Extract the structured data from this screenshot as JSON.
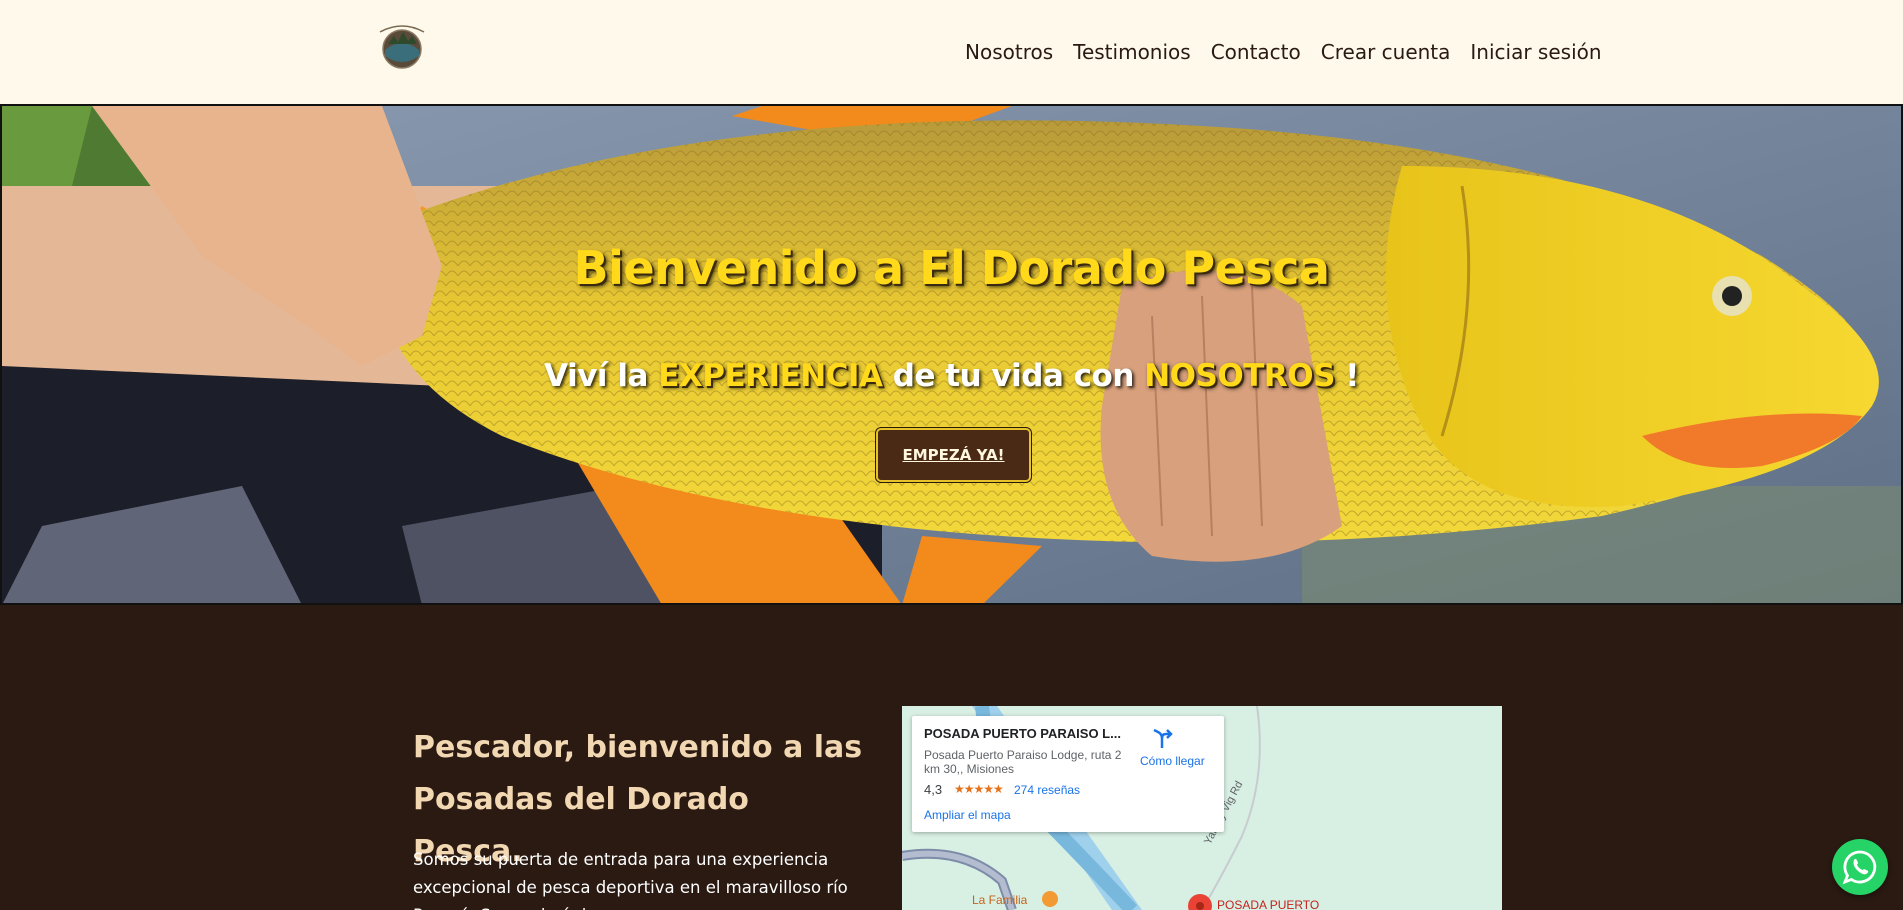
{
  "header": {
    "logo": {
      "icon": "lodge-logo-icon"
    },
    "nav": [
      {
        "label": "Nosotros"
      },
      {
        "label": "Testimonios"
      },
      {
        "label": "Contacto"
      },
      {
        "label": "Crear cuenta"
      },
      {
        "label": "Iniciar sesión"
      }
    ]
  },
  "hero": {
    "title": "Bienvenido a El Dorado Pesca",
    "subtitle_prefix": "Viví la ",
    "subtitle_highlight_1": "EXPERIENCIA",
    "subtitle_middle": " de tu vida con ",
    "subtitle_highlight_2": "NOSOTROS",
    "subtitle_suffix": " !",
    "cta_label": "EMPEZÁ YA!",
    "highlight_color": "#ffd91a"
  },
  "about": {
    "title": "Pescador, bienvenido a las Posadas del Dorado Pesca.",
    "text": "Somos su puerta de entrada para una experiencia excepcional de pesca deportiva en el maravilloso río Paraná. Somos la única"
  },
  "map": {
    "place_name": "POSADA PUERTO PARAISO L...",
    "address": "Posada Puerto Paraiso Lodge, ruta 2 km 30,, Misiones",
    "rating": "4,3",
    "stars": "★★★★★",
    "reviews": "274 reseñas",
    "directions_label": "Cómo llegar",
    "enlarge_label": "Ampliar el mapa",
    "road_label": "Yaborý Vig Rd",
    "poi_label": "La Familia",
    "pin_label": "POSADA PUERTO"
  },
  "whatsapp": {
    "icon": "whatsapp-icon",
    "color": "#25d366"
  }
}
